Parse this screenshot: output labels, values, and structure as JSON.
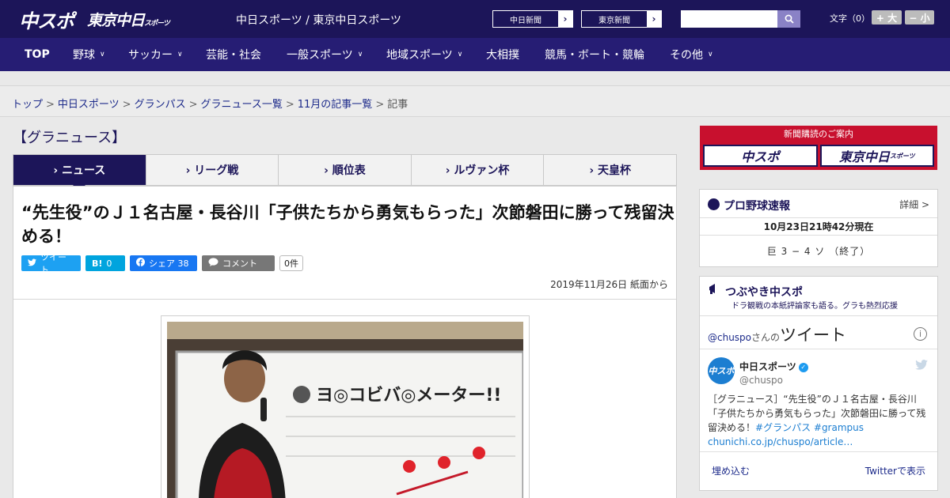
{
  "header": {
    "logo_chuspo": "中スポ",
    "logo_tokyo": "東京中日",
    "logo_tokyo_small": "スポーツ",
    "site_name": "中日スポーツ / 東京中日スポーツ",
    "paper_links": [
      {
        "label": "中日新聞",
        "arrow": "›"
      },
      {
        "label": "東京新聞",
        "arrow": "›"
      }
    ],
    "search_placeholder": "",
    "font_size_label": "文字（0）",
    "font_up": "+ 大",
    "font_down": "− 小"
  },
  "nav": [
    {
      "label": "TOP",
      "chevron": ""
    },
    {
      "label": "野球",
      "chevron": "∨"
    },
    {
      "label": "サッカー",
      "chevron": "∨"
    },
    {
      "label": "芸能・社会",
      "chevron": ""
    },
    {
      "label": "一般スポーツ",
      "chevron": "∨"
    },
    {
      "label": "地域スポーツ",
      "chevron": "∨"
    },
    {
      "label": "大相撲",
      "chevron": ""
    },
    {
      "label": "競馬・ボート・競輪",
      "chevron": ""
    },
    {
      "label": "その他",
      "chevron": "∨"
    }
  ],
  "breadcrumb": {
    "items": [
      "トップ",
      "中日スポーツ",
      "グランパス",
      "グラニュース一覧",
      "11月の記事一覧"
    ],
    "current": "記事",
    "separator": ">"
  },
  "section_title": "【グラニュース】",
  "tabs": [
    "› ニュース",
    "› リーグ戦",
    "› 順位表",
    "› ルヴァン杯",
    "› 天皇杯"
  ],
  "article": {
    "headline": "“先生役”のＪ１名古屋・長谷川「子供たちから勇気もらった」次節磐田に勝って残留決める！",
    "share": {
      "tweet": "ツイート",
      "hatena_icon": "B!",
      "hatena_count": "0",
      "facebook": "シェア",
      "facebook_count": "38",
      "comment": "コメント",
      "comment_count": "0件"
    },
    "dateline": "2019年11月26日 紙面から",
    "photo_board_text": "ヨ◎コビバ◎メーター!!"
  },
  "sidebar": {
    "promo_title": "新聞購読のご案内",
    "promo_logos": [
      "中スポ",
      "東京中日"
    ],
    "promo_logo_small": "スポーツ",
    "baseball": {
      "title": "プロ野球速報",
      "more": "詳細 >",
      "time": "10月23日21時42分現在",
      "score": "巨 3 − 4 ソ （終了）"
    },
    "tweets": {
      "title": "つぶやき中スポ",
      "subtitle": "ドラ観戦の本紙評論家も語る。グラも熱烈応援",
      "handle_link": "@chuspo",
      "handle_suffix": "さんの",
      "big_label": "ツイート",
      "info": "i",
      "account_name": "中日スポーツ",
      "account_handle": "@chuspo",
      "avatar_text": "中スポ",
      "tweet_text": "［グラニュース］“先生役”のＪ１名古屋・長谷川「子供たちから勇気もらった」次節磐田に勝って残留決める！",
      "hashtags": "#グランパス #grampus",
      "link": "chunichi.co.jp/chuspo/article…",
      "embed": "埋め込む",
      "view_on_twitter": "Twitterで表示"
    }
  },
  "colors": {
    "brand_navy": "#1c1559",
    "nav_purple": "#261d74",
    "promo_red": "#c8102e",
    "twitter_blue": "#1da1f2",
    "hatena_blue": "#00a4de",
    "facebook_blue": "#1877f2",
    "comment_gray": "#777777"
  }
}
